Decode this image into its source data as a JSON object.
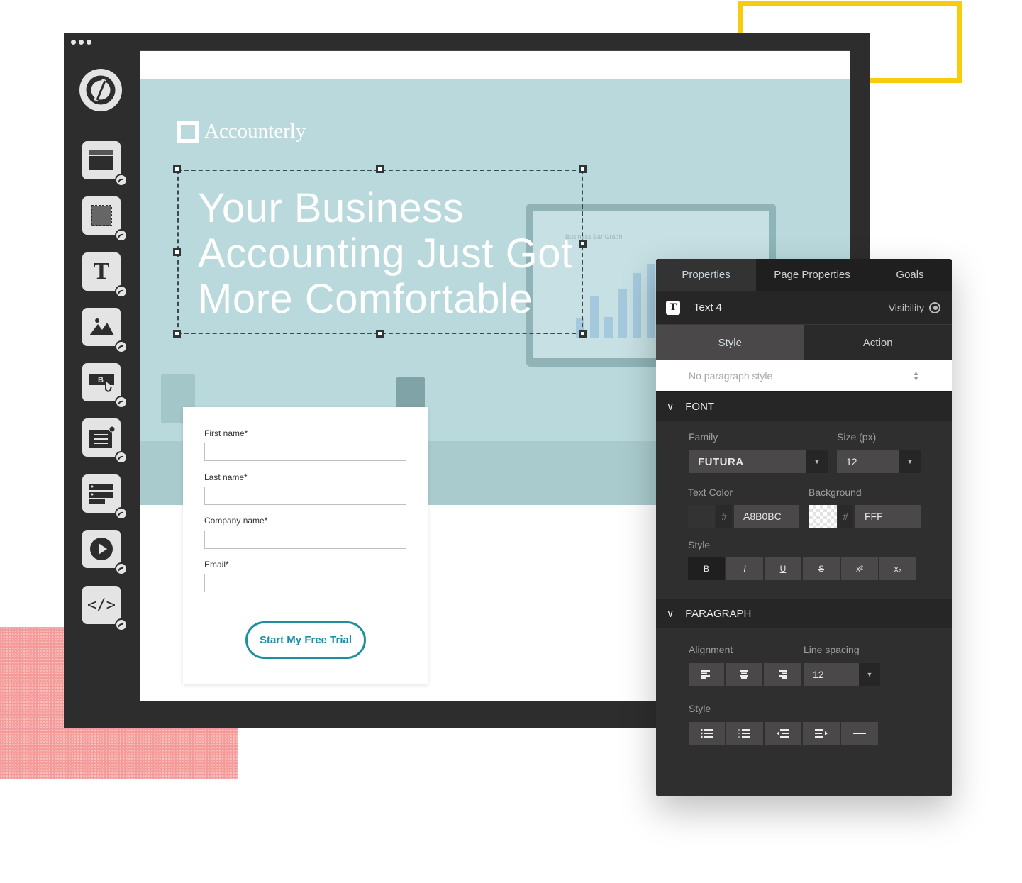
{
  "decor": {
    "yellow_accent": "#f7cc0c",
    "pink_accent": "#f49a98"
  },
  "sidebar": {
    "logo_icon": "unbounce-logo-icon",
    "tools": [
      {
        "name": "section",
        "icon": "section-block-icon"
      },
      {
        "name": "box",
        "icon": "box-block-icon"
      },
      {
        "name": "text",
        "icon": "text-block-icon"
      },
      {
        "name": "image",
        "icon": "image-block-icon"
      },
      {
        "name": "button",
        "icon": "button-block-icon"
      },
      {
        "name": "lightbox",
        "icon": "lightbox-block-icon"
      },
      {
        "name": "form",
        "icon": "form-block-icon"
      },
      {
        "name": "video",
        "icon": "video-block-icon"
      },
      {
        "name": "custom-html",
        "icon": "code-block-icon"
      }
    ]
  },
  "page": {
    "brand": "Accounterly",
    "headline_lines": [
      "Your Business",
      "Accounting Just Got",
      "More Comfortable"
    ],
    "monitor_title": "Business Bar Graph",
    "hero_color": "#b9d9dc",
    "form": {
      "fields": [
        {
          "label": "First name*",
          "value": ""
        },
        {
          "label": "Last name*",
          "value": ""
        },
        {
          "label": "Company name*",
          "value": ""
        },
        {
          "label": "Email*",
          "value": ""
        }
      ],
      "submit_label": "Start My Free Trial",
      "accent": "#1e8ea3"
    }
  },
  "panel": {
    "tabs": [
      "Properties",
      "Page Properties",
      "Goals"
    ],
    "active_tab": "Properties",
    "element": {
      "icon": "T",
      "name": "Text 4",
      "visibility_label": "Visibility"
    },
    "subtabs": [
      "Style",
      "Action"
    ],
    "paragraph_style": "No paragraph style",
    "font": {
      "section_title": "FONT",
      "family_label": "Family",
      "family_value": "FUTURA",
      "size_label": "Size (px)",
      "size_value": "12",
      "text_color_label": "Text Color",
      "text_color_hash": "#",
      "text_color_value": "A8B0BC",
      "background_label": "Background",
      "background_hash": "#",
      "background_value": "FFF",
      "style_label": "Style",
      "style_buttons": [
        "B",
        "I",
        "U",
        "S",
        "x²",
        "x₂"
      ]
    },
    "paragraph": {
      "section_title": "PARAGRAPH",
      "alignment_label": "Alignment",
      "line_spacing_label": "Line spacing",
      "line_spacing_value": "12",
      "style_label": "Style"
    }
  }
}
